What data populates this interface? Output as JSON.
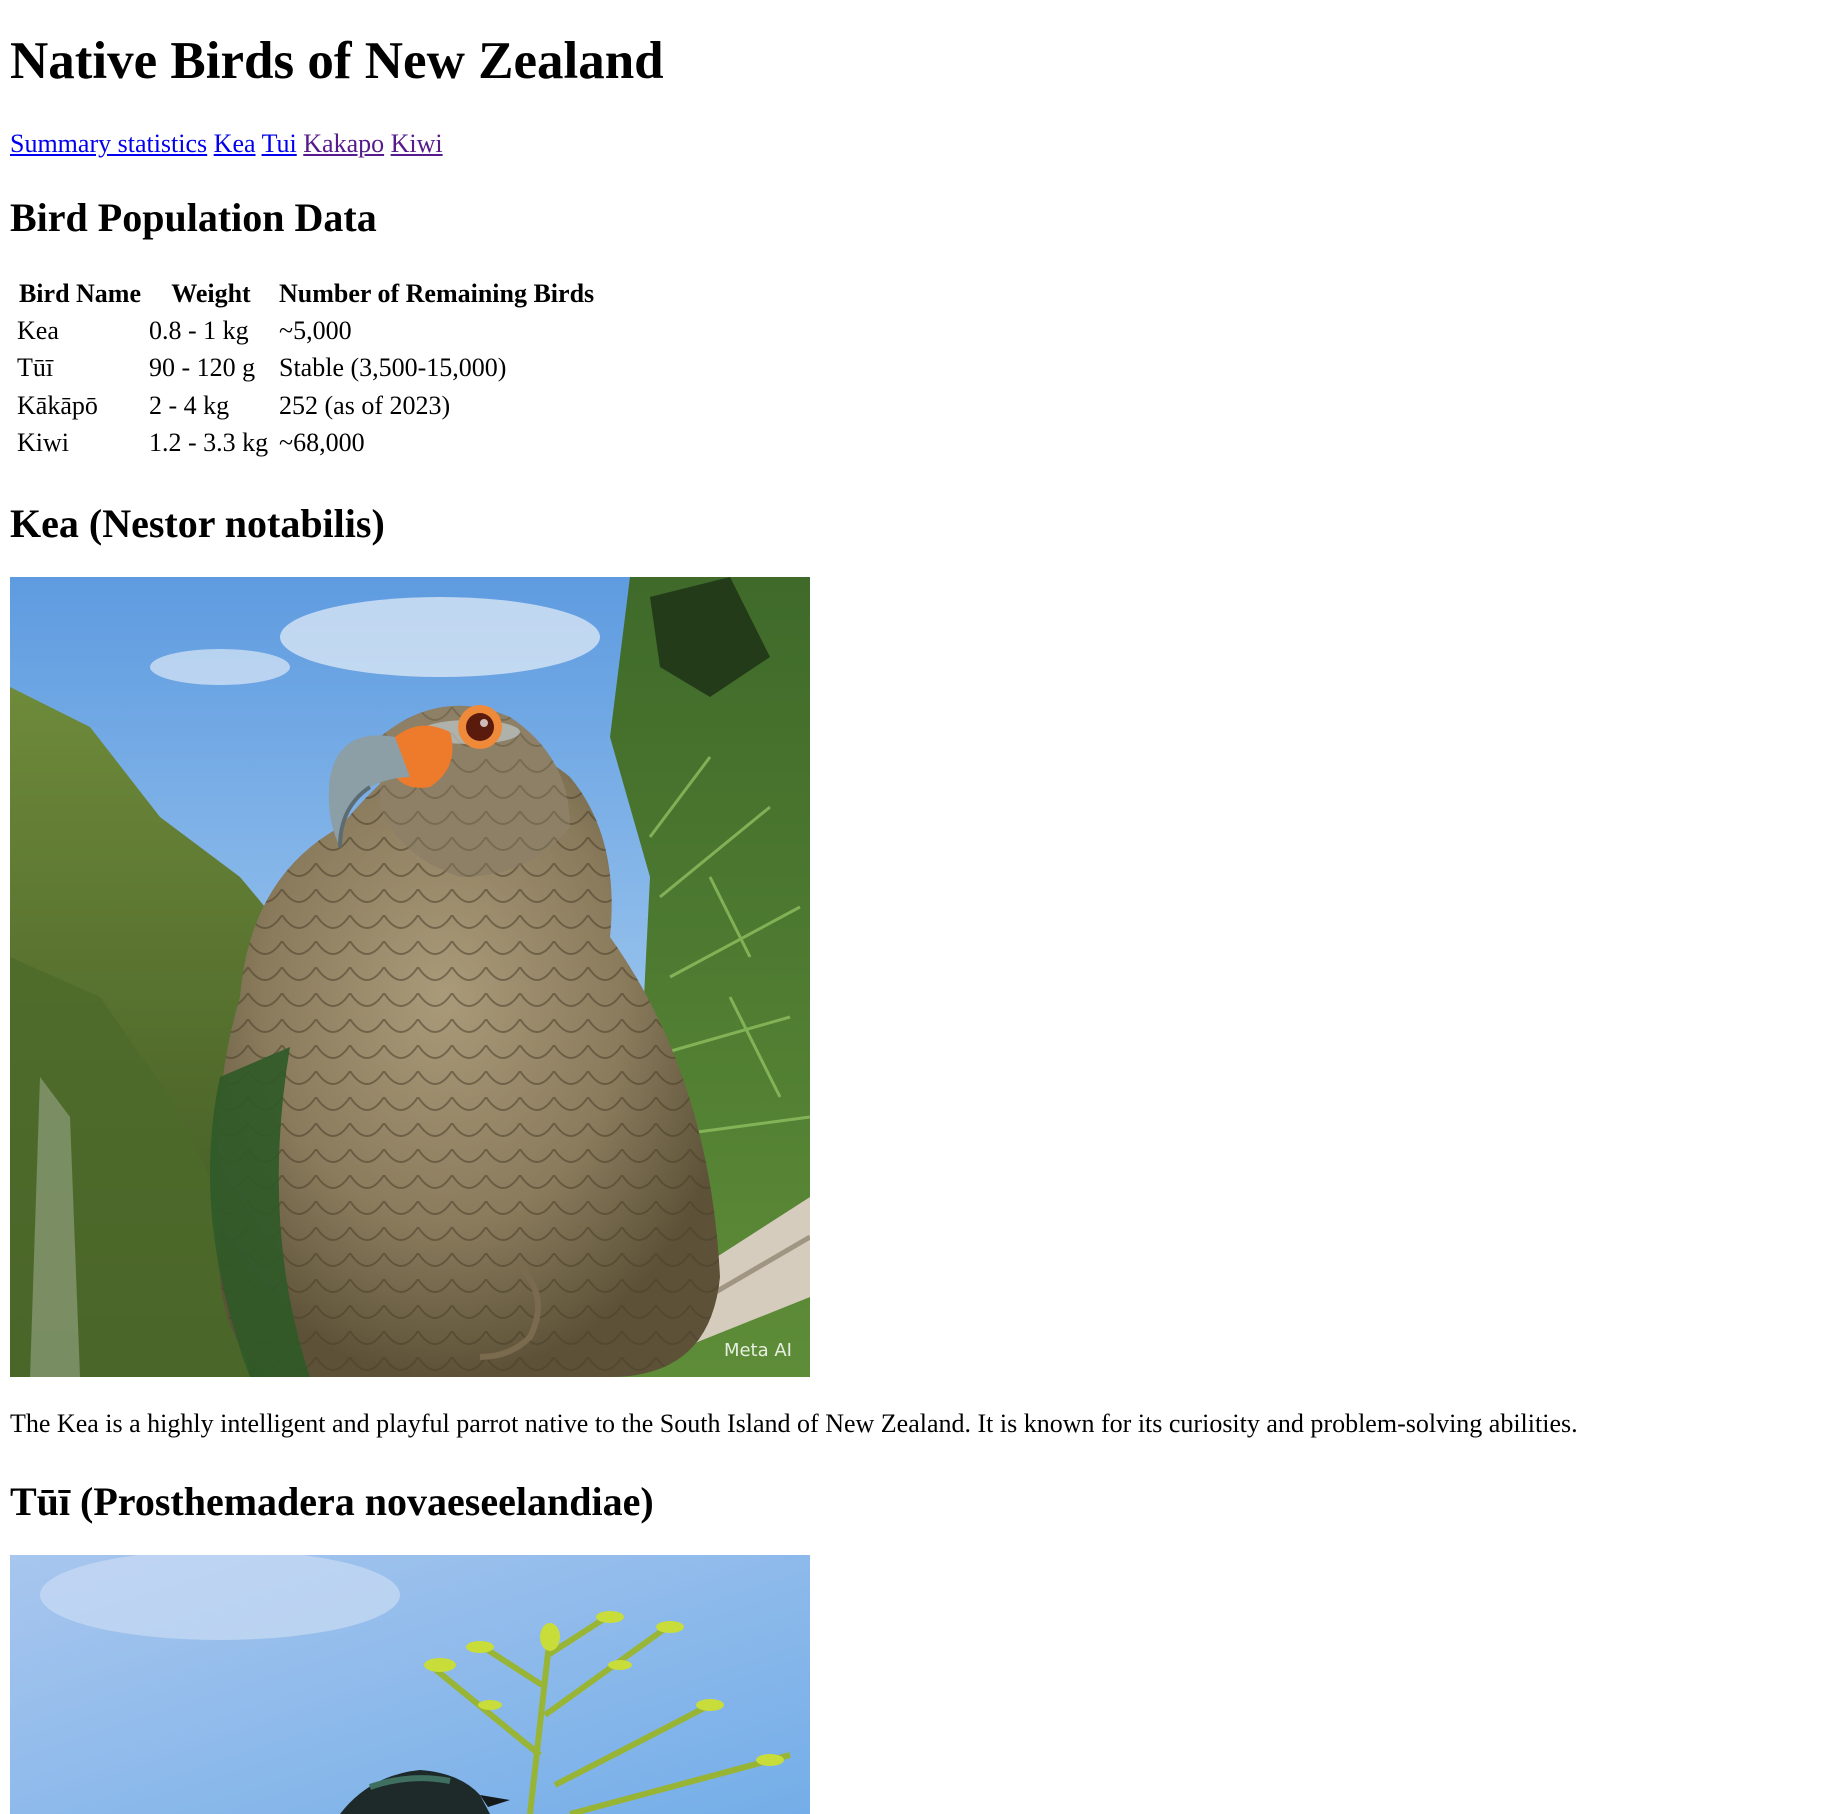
{
  "page_title": "Native Birds of New Zealand",
  "nav": {
    "links": [
      {
        "label": "Summary statistics",
        "visited": false
      },
      {
        "label": "Kea",
        "visited": false
      },
      {
        "label": "Tui",
        "visited": false
      },
      {
        "label": "Kakapo",
        "visited": true
      },
      {
        "label": "Kiwi",
        "visited": true
      }
    ]
  },
  "population": {
    "heading": "Bird Population Data",
    "columns": [
      "Bird Name",
      "Weight",
      "Number of Remaining Birds"
    ],
    "rows": [
      [
        "Kea",
        "0.8 - 1 kg",
        "~5,000"
      ],
      [
        "Tūī",
        "90 - 120 g",
        "Stable (3,500-15,000)"
      ],
      [
        "Kākāpō",
        "2 - 4 kg",
        "252 (as of 2023)"
      ],
      [
        "Kiwi",
        "1.2 - 3.3 kg",
        "~68,000"
      ]
    ]
  },
  "kea": {
    "heading": "Kea (Nestor notabilis)",
    "image_watermark": "Meta AI",
    "description": "The Kea is a highly intelligent and playful parrot native to the South Island of New Zealand. It is known for its curiosity and problem-solving abilities."
  },
  "tui": {
    "heading": "Tūī (Prosthemadera novaeseelandiae)"
  },
  "colors": {
    "link": "#0000ee",
    "link_visited": "#551a8b"
  }
}
